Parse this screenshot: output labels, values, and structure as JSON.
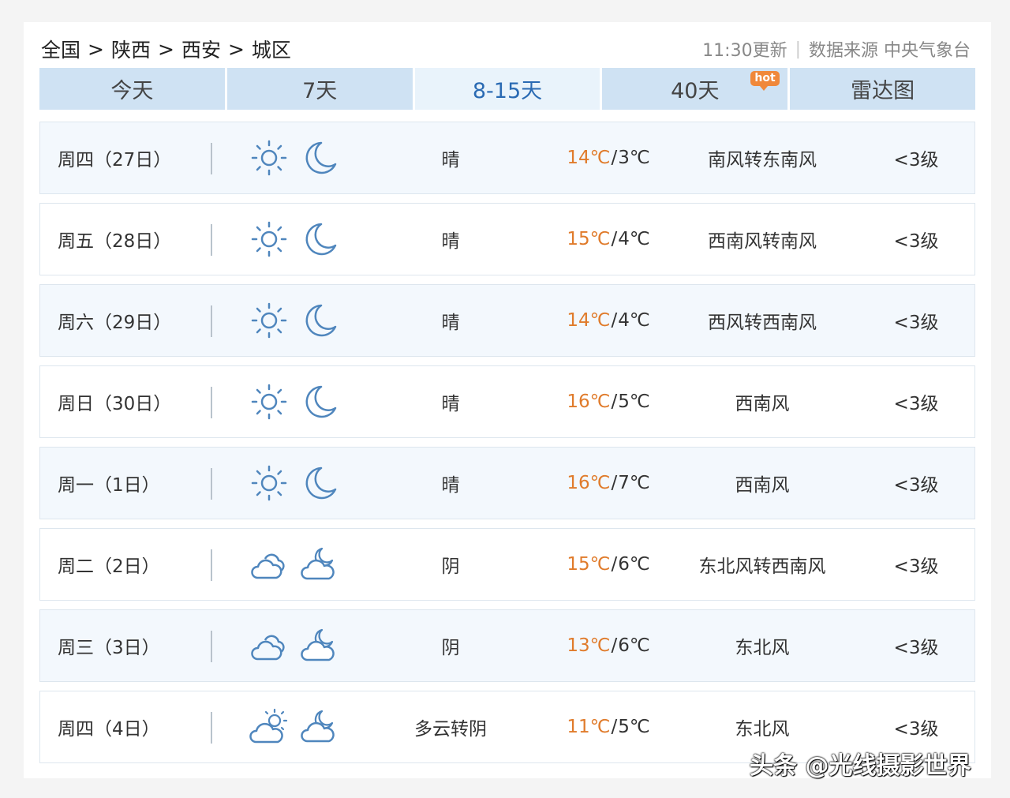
{
  "breadcrumb": [
    "全国",
    "陕西",
    "西安",
    "城区"
  ],
  "breadcrumb_sep": ">",
  "update_time": "11:30更新",
  "source": "数据来源 中央气象台",
  "tabs": [
    {
      "label": "今天"
    },
    {
      "label": "7天"
    },
    {
      "label": "8-15天"
    },
    {
      "label": "40天",
      "badge": "hot"
    },
    {
      "label": "雷达图"
    }
  ],
  "active_tab": "8-15天",
  "days": [
    {
      "date": "周四（27日）",
      "day_icon": "sunny-icon",
      "night_icon": "moon-icon",
      "weather": "晴",
      "high": "14℃",
      "low": "3℃",
      "wind": "南风转东南风",
      "level": "<3级"
    },
    {
      "date": "周五（28日）",
      "day_icon": "sunny-icon",
      "night_icon": "moon-icon",
      "weather": "晴",
      "high": "15℃",
      "low": "4℃",
      "wind": "西南风转南风",
      "level": "<3级"
    },
    {
      "date": "周六（29日）",
      "day_icon": "sunny-icon",
      "night_icon": "moon-icon",
      "weather": "晴",
      "high": "14℃",
      "low": "4℃",
      "wind": "西风转西南风",
      "level": "<3级"
    },
    {
      "date": "周日（30日）",
      "day_icon": "sunny-icon",
      "night_icon": "moon-icon",
      "weather": "晴",
      "high": "16℃",
      "low": "5℃",
      "wind": "西南风",
      "level": "<3级"
    },
    {
      "date": "周一（1日）",
      "day_icon": "sunny-icon",
      "night_icon": "moon-icon",
      "weather": "晴",
      "high": "16℃",
      "low": "7℃",
      "wind": "西南风",
      "level": "<3级"
    },
    {
      "date": "周二（2日）",
      "day_icon": "overcast-icon",
      "night_icon": "cloudy-night-icon",
      "weather": "阴",
      "high": "15℃",
      "low": "6℃",
      "wind": "东北风转西南风",
      "level": "<3级"
    },
    {
      "date": "周三（3日）",
      "day_icon": "overcast-icon",
      "night_icon": "cloudy-night-icon",
      "weather": "阴",
      "high": "13℃",
      "low": "6℃",
      "wind": "东北风",
      "level": "<3级"
    },
    {
      "date": "周四（4日）",
      "day_icon": "partly-cloudy-icon",
      "night_icon": "cloudy-night-icon",
      "weather": "多云转阴",
      "high": "11℃",
      "low": "5℃",
      "wind": "东北风",
      "level": "<3级"
    }
  ],
  "colors": {
    "high_temp": "#e07b2b",
    "icon": "#4f86bd",
    "active_tab_text": "#2a6ab3"
  },
  "watermark": "头条 @光线摄影世界"
}
